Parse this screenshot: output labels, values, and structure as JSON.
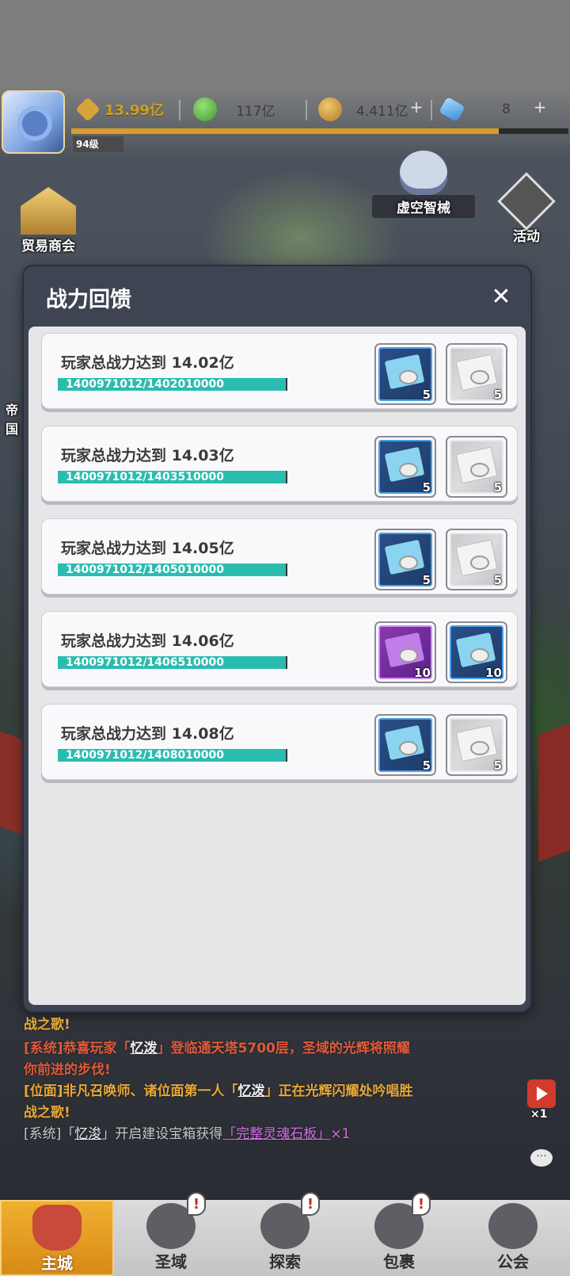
{
  "hud": {
    "combat_power": "13.99亿",
    "green_currency": "117亿",
    "gold_currency": "4.411亿",
    "diamond_currency": "8",
    "level": "94级",
    "xp_fraction": 0.86
  },
  "side": {
    "trade": "贸易商会",
    "robot": "虚空智械",
    "activity": "活动",
    "empire": "帝国"
  },
  "dialog": {
    "title": "战力回馈",
    "close": "✕",
    "tasks": [
      {
        "title": "玩家总战力达到 14.02亿",
        "progress": "1400971012/1402010000",
        "rewards": [
          {
            "tier": "blue",
            "count": "5"
          },
          {
            "tier": "white",
            "count": "5"
          }
        ]
      },
      {
        "title": "玩家总战力达到 14.03亿",
        "progress": "1400971012/1403510000",
        "rewards": [
          {
            "tier": "blue",
            "count": "5"
          },
          {
            "tier": "white",
            "count": "5"
          }
        ]
      },
      {
        "title": "玩家总战力达到 14.05亿",
        "progress": "1400971012/1405010000",
        "rewards": [
          {
            "tier": "blue",
            "count": "5"
          },
          {
            "tier": "white",
            "count": "5"
          }
        ]
      },
      {
        "title": "玩家总战力达到 14.06亿",
        "progress": "1400971012/1406510000",
        "rewards": [
          {
            "tier": "purple",
            "count": "10"
          },
          {
            "tier": "blue",
            "count": "10"
          }
        ]
      },
      {
        "title": "玩家总战力达到 14.08亿",
        "progress": "1400971012/1408010000",
        "rewards": [
          {
            "tier": "blue",
            "count": "5"
          },
          {
            "tier": "white",
            "count": "5"
          }
        ]
      }
    ]
  },
  "chat": {
    "line1": "战之歌!",
    "line2_prefix": "[系统]恭喜玩家「",
    "line2_name": "忆泼",
    "line2_suffix": "」登临通天塔5700层，圣域的光辉将照耀",
    "line3": "你前进的步伐!",
    "line4_prefix": "[位面]非凡召唤师、诸位面第一人「",
    "line4_name": "忆泼",
    "line4_suffix": "」正在光辉闪耀处吟唱胜",
    "line5": "战之歌!",
    "line6_prefix": "[系统]「",
    "line6_name": "忆浚",
    "line6_mid": "」开启建设宝箱获得",
    "line6_item": "「完整灵魂石板」",
    "line6_count": "×1",
    "video_count": "×1",
    "chat_icon": "···"
  },
  "nav": {
    "items": [
      {
        "label": "主城",
        "badge": ""
      },
      {
        "label": "圣域",
        "badge": "!"
      },
      {
        "label": "探索",
        "badge": "!"
      },
      {
        "label": "包裹",
        "badge": "!"
      },
      {
        "label": "公会",
        "badge": ""
      }
    ]
  },
  "colors": {
    "progress": "#2bbcb0",
    "xp": "#d99b2a",
    "chat_system": "#e05a3a",
    "chat_plane": "#e8a838",
    "nav_active": "#e89e22"
  }
}
